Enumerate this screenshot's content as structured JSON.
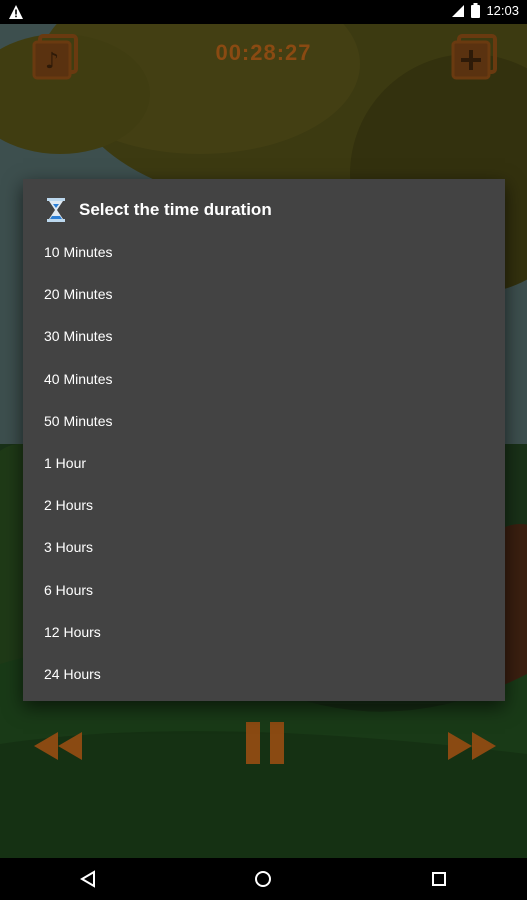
{
  "status_bar": {
    "time": "12:03",
    "icons": [
      "warning-icon",
      "signal-icon",
      "battery-icon"
    ]
  },
  "player": {
    "timer": "00:28:27",
    "accent_color": "#8a4a12",
    "left_button_icon": "music-note-icon",
    "right_button_icon": "add-icon"
  },
  "dialog": {
    "icon": "hourglass-icon",
    "title": "Select the time duration",
    "options": [
      {
        "label": "10 Minutes"
      },
      {
        "label": "20 Minutes"
      },
      {
        "label": "30 Minutes"
      },
      {
        "label": "40 Minutes"
      },
      {
        "label": "50 Minutes"
      },
      {
        "label": "1 Hour"
      },
      {
        "label": "2 Hours"
      },
      {
        "label": "3 Hours"
      },
      {
        "label": "6 Hours"
      },
      {
        "label": "12 Hours"
      },
      {
        "label": "24 Hours"
      }
    ]
  },
  "controls": {
    "rewind_icon": "rewind-icon",
    "pause_icon": "pause-icon",
    "forward_icon": "fast-forward-icon"
  },
  "nav": {
    "back_icon": "back-icon",
    "home_icon": "home-icon",
    "recents_icon": "recents-icon"
  }
}
